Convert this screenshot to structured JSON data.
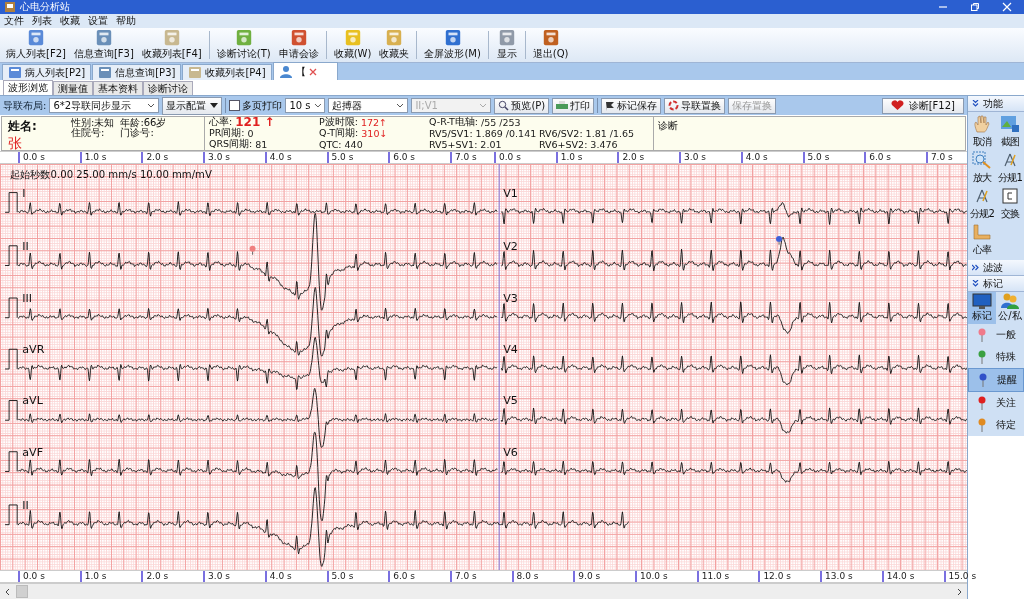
{
  "window": {
    "title": "心电分析站"
  },
  "menu": [
    "文件",
    "列表",
    "收藏",
    "设置",
    "帮助"
  ],
  "toolbar_groups": [
    {
      "buttons": [
        "病人列表[F2]",
        "信息查询[F3]",
        "收藏列表[F4]"
      ]
    },
    {
      "buttons": [
        "诊断讨论(T)",
        "申请会诊"
      ]
    },
    {
      "buttons": [
        "收藏(W)",
        "收藏夹"
      ]
    },
    {
      "buttons": [
        "全屏波形(M)"
      ]
    },
    {
      "buttons": [
        "显示"
      ]
    },
    {
      "buttons": [
        "退出(Q)"
      ]
    }
  ],
  "doc_tabs": [
    {
      "label": "病人列表[P2]",
      "selected": false,
      "closable": false
    },
    {
      "label": "信息查询[P3]",
      "selected": false,
      "closable": false
    },
    {
      "label": "收藏列表[P4]",
      "selected": false,
      "closable": false
    },
    {
      "label": "【",
      "selected": true,
      "closable": true
    }
  ],
  "view_tabs": [
    {
      "label": "波形浏览",
      "selected": true
    },
    {
      "label": "测量值",
      "selected": false
    },
    {
      "label": "基本资料",
      "selected": false
    },
    {
      "label": "诊断讨论",
      "selected": false
    }
  ],
  "controls": {
    "layout_label": "导联布局:",
    "layout_value": "6*2导联同步显示",
    "display_config": "显示配置",
    "multi_page_print": {
      "label": "多页打印",
      "checked": false
    },
    "duration": "10 s",
    "pacemaker": "起搏器",
    "lead_select": {
      "value": "II;V1",
      "disabled": true
    },
    "buttons": [
      {
        "label": "预览(P)",
        "disabled": false
      },
      {
        "label": "打印",
        "disabled": false
      },
      {
        "label": "标记保存",
        "disabled": false
      },
      {
        "label": "导联置换",
        "disabled": false
      },
      {
        "label": "保存置换",
        "disabled": true
      }
    ],
    "diagnose": "诊断[F12]"
  },
  "patient": {
    "name_label": "姓名:",
    "name": "张",
    "fields": [
      {
        "label": "性别:",
        "value": "未知"
      },
      {
        "label": "年龄:",
        "value": "66岁"
      },
      {
        "label": "住院号:"
      },
      {
        "label": "门诊号:"
      }
    ]
  },
  "measurements": {
    "rows": [
      [
        {
          "kind": "rate",
          "label": "心率:",
          "value": "121 ↑",
          "abnormal": true
        },
        {
          "kind": "value",
          "label": "P波时限:",
          "value": "172↑",
          "abnormal": true
        },
        {
          "kind": "value",
          "label": "Q-R-T电轴:",
          "value": "/55    /253",
          "abnormal": false
        }
      ],
      [
        {
          "kind": "value",
          "label": "PR间期:",
          "value": "0",
          "abnormal": false
        },
        {
          "kind": "value",
          "label": "Q-T间期:",
          "value": "310↓",
          "abnormal": true
        },
        {
          "kind": "value",
          "label": "RV5/SV1:",
          "value": "1.869 /0.141",
          "abnormal": false
        },
        {
          "kind": "value",
          "label": "RV6/SV2:",
          "value": "1.81 /1.65",
          "abnormal": false
        }
      ],
      [
        {
          "kind": "value",
          "label": "QRS间期:",
          "value": "81",
          "abnormal": false
        },
        {
          "kind": "value",
          "label": "QTC:",
          "value": "440",
          "abnormal": false
        },
        {
          "kind": "value",
          "label": "RV5+SV1:",
          "value": "2.01",
          "abnormal": false
        },
        {
          "kind": "value",
          "label": "RV6+SV2:",
          "value": "3.476",
          "abnormal": false
        }
      ]
    ]
  },
  "diagnosis": {
    "label": "诊断"
  },
  "ecg": {
    "header": "起始秒数0.00  25.00 mm/s  10.00 mm/mV",
    "top_axis_left": [
      "0.0 s",
      "1.0 s",
      "2.0 s",
      "3.0 s",
      "4.0 s",
      "5.0 s",
      "6.0 s",
      "7.0 s"
    ],
    "top_axis_right": [
      "0.0 s",
      "1.0 s",
      "2.0 s",
      "3.0 s",
      "4.0 s",
      "5.0 s",
      "6.0 s",
      "7.0 s"
    ],
    "bottom_axis": [
      "0.0 s",
      "1.0 s",
      "2.0 s",
      "3.0 s",
      "4.0 s",
      "5.0 s",
      "6.0 s",
      "7.0 s",
      "8.0 s",
      "9.0 s",
      "10.0 s",
      "11.0 s",
      "12.0 s",
      "13.0 s",
      "14.0 s",
      "15.0 s"
    ],
    "left_leads": [
      "I",
      "II",
      "III",
      "aVR",
      "aVL",
      "aVF"
    ],
    "right_leads": [
      "V1",
      "V2",
      "V3",
      "V4",
      "V5",
      "V6"
    ],
    "rhythm_lead": "II",
    "markers": [
      {
        "color": "#f08080"
      },
      {
        "color": "#4060d8"
      }
    ]
  },
  "side_panel": {
    "function": {
      "title": "功能",
      "expanded": true,
      "tools": [
        "取消",
        "截图",
        "放大",
        "分规1",
        "分规2",
        "交换",
        "心率"
      ]
    },
    "filter": {
      "title": "滤波",
      "expanded": false
    },
    "mark": {
      "title": "标记",
      "expanded": true,
      "modes": [
        "标记",
        "公/私"
      ],
      "pins": [
        {
          "label": "一般",
          "color": "#f07a8a",
          "selected": false
        },
        {
          "label": "特殊",
          "color": "#3aa040",
          "selected": false
        },
        {
          "label": "提醒",
          "color": "#3050c8",
          "selected": true
        },
        {
          "label": "关注",
          "color": "#e02020",
          "selected": false
        },
        {
          "label": "待定",
          "color": "#e08a20",
          "selected": false
        }
      ]
    }
  }
}
